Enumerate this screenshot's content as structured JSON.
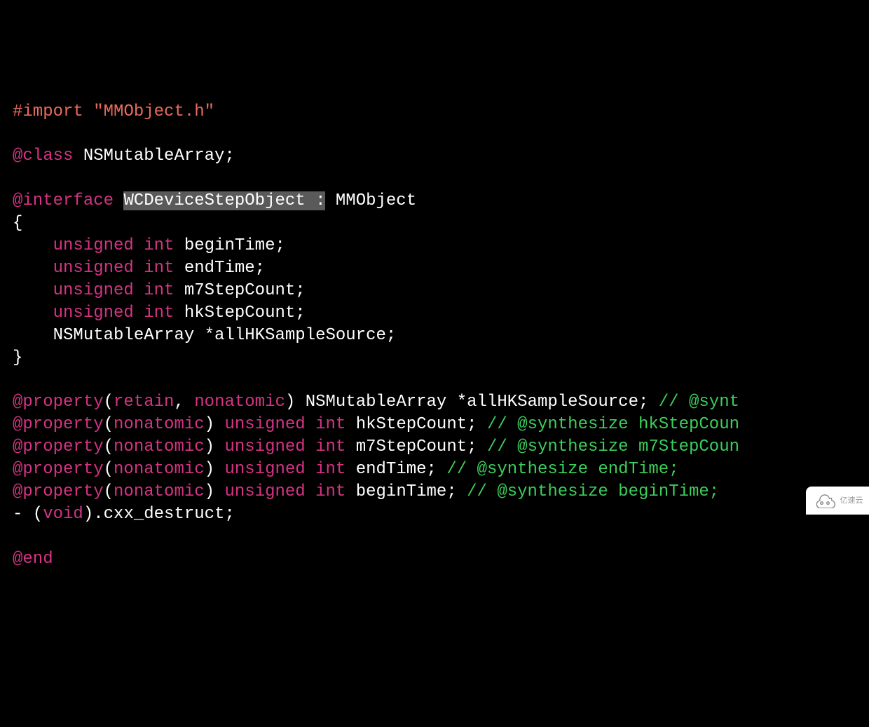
{
  "code": {
    "l1": {
      "directive": "#import",
      "string": "\"MMObject.h\""
    },
    "l3": {
      "kw": "@class",
      "txt": " NSMutableArray;"
    },
    "l5": {
      "kw": "@interface",
      "sp": " ",
      "hl": "WCDeviceStepObject :",
      "rest": " MMObject"
    },
    "l6": "{",
    "l7": {
      "indent": "    ",
      "t1": "unsigned",
      "t2": "int",
      "name": " beginTime;"
    },
    "l8": {
      "indent": "    ",
      "t1": "unsigned",
      "t2": "int",
      "name": " endTime;"
    },
    "l9": {
      "indent": "    ",
      "t1": "unsigned",
      "t2": "int",
      "name": " m7StepCount;"
    },
    "l10": {
      "indent": "    ",
      "t1": "unsigned",
      "t2": "int",
      "name": " hkStepCount;"
    },
    "l11": {
      "indent": "    ",
      "txt": "NSMutableArray *allHKSampleSource;"
    },
    "l12": "}",
    "l14": {
      "kw": "@property",
      "p": "(",
      "a1": "retain",
      "c": ", ",
      "a2": "nonatomic",
      "pe": ")",
      "rest": " NSMutableArray *allHKSampleSource; ",
      "cm": "// @synt"
    },
    "l15": {
      "kw": "@property",
      "p": "(",
      "a1": "nonatomic",
      "pe": ") ",
      "t1": "unsigned",
      "sp": " ",
      "t2": "int",
      "rest": " hkStepCount; ",
      "cm": "// @synthesize hkStepCoun"
    },
    "l16": {
      "kw": "@property",
      "p": "(",
      "a1": "nonatomic",
      "pe": ") ",
      "t1": "unsigned",
      "sp": " ",
      "t2": "int",
      "rest": " m7StepCount; ",
      "cm": "// @synthesize m7StepCoun"
    },
    "l17": {
      "kw": "@property",
      "p": "(",
      "a1": "nonatomic",
      "pe": ") ",
      "t1": "unsigned",
      "sp": " ",
      "t2": "int",
      "rest": " endTime; ",
      "cm": "// @synthesize endTime;"
    },
    "l18": {
      "kw": "@property",
      "p": "(",
      "a1": "nonatomic",
      "pe": ") ",
      "t1": "unsigned",
      "sp": " ",
      "t2": "int",
      "rest": " beginTime; ",
      "cm": "// @synthesize beginTime;"
    },
    "l19": {
      "pre": "- (",
      "t": "void",
      "post": ").cxx_destruct;"
    },
    "l21": "@end"
  },
  "watermark": "亿速云"
}
